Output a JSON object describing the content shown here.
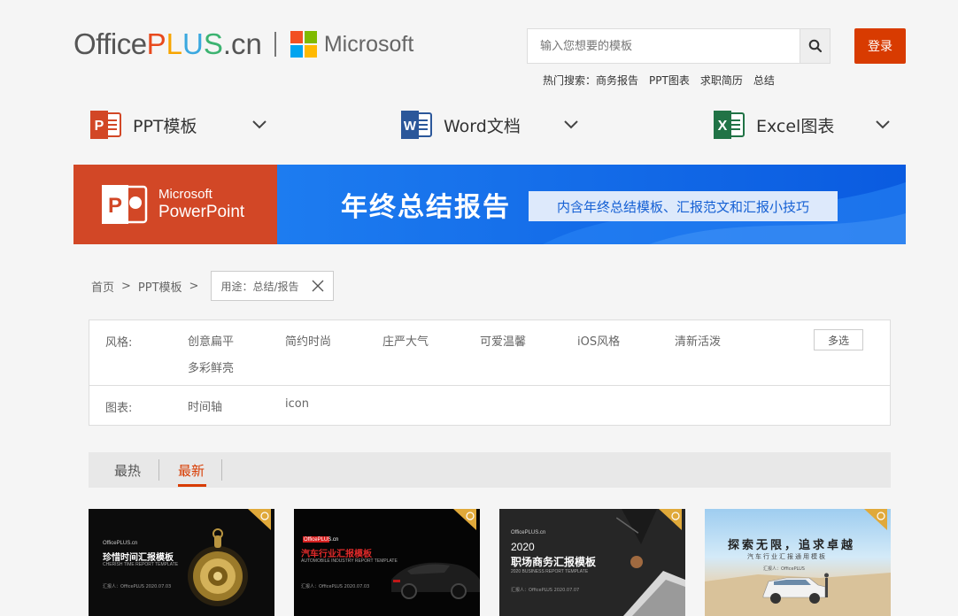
{
  "header": {
    "logo_office": "Office",
    "logo_plus": [
      "P",
      "L",
      "U",
      "S"
    ],
    "logo_plus_colors": [
      "#e8491d",
      "#f7a400",
      "#3aa8df",
      "#3cb371"
    ],
    "logo_cn": ".cn",
    "microsoft": "Microsoft",
    "ms_colors": [
      "#f25022",
      "#7fba00",
      "#00a4ef",
      "#ffb900"
    ],
    "search_placeholder": "输入您想要的模板",
    "login_label": "登录",
    "hot_label": "热门搜索：",
    "hot_items": [
      "商务报告",
      "PPT图表",
      "求职简历",
      "总结"
    ]
  },
  "categories": [
    {
      "label": "PPT模板",
      "icon": "powerpoint-icon",
      "color": "#d24726",
      "letter": "P"
    },
    {
      "label": "Word文档",
      "icon": "word-icon",
      "color": "#2b579a",
      "letter": "W"
    },
    {
      "label": "Excel图表",
      "icon": "excel-icon",
      "color": "#217346",
      "letter": "X"
    }
  ],
  "banner": {
    "ms_line1": "Microsoft",
    "ms_line2": "PowerPoint",
    "title": "年终总结报告",
    "pill": "内含年终总结模板、汇报范文和汇报小技巧"
  },
  "breadcrumb": {
    "home": "首页",
    "sep": ">",
    "ppt": "PPT模板",
    "filter": "用途：总结/报告"
  },
  "filters": {
    "style_label": "风格:",
    "style_options": [
      "创意扁平",
      "简约时尚",
      "庄严大气",
      "可爱温馨",
      "iOS风格",
      "清新活泼",
      "多彩鲜亮"
    ],
    "multi_label": "多选",
    "chart_label": "图表:",
    "chart_options": [
      "时间轴",
      "icon"
    ]
  },
  "sort": {
    "tabs": [
      "最热",
      "最新"
    ],
    "active": "最新"
  },
  "cards": [
    {
      "brand": "OfficePLUS.cn",
      "title": "珍惜时间汇报模板",
      "sub": "CHERISH TIME REPORT TEMPLATE",
      "meta": "汇报人：OfficePLUS    2020.07.03"
    },
    {
      "brand": "OfficePLUS.cn",
      "title": "汽车行业汇报模板",
      "sub": "AUTOMOBILE INDUSTRY REPORT TEMPLATE",
      "meta": "汇报人：OfficePLUS    2020.07.03"
    },
    {
      "brand": "OfficePLUS.cn",
      "year": "2020",
      "title": "职场商务汇报模板",
      "sub": "2020 BUSINESS REPORT TEMPLATE",
      "meta": "汇报人：OfficePLUS    2020.07.07"
    },
    {
      "title": "探索无限，追求卓越",
      "sub": "汽车行业汇报通用模板",
      "meta": "汇报人：OfficePLUS"
    }
  ]
}
